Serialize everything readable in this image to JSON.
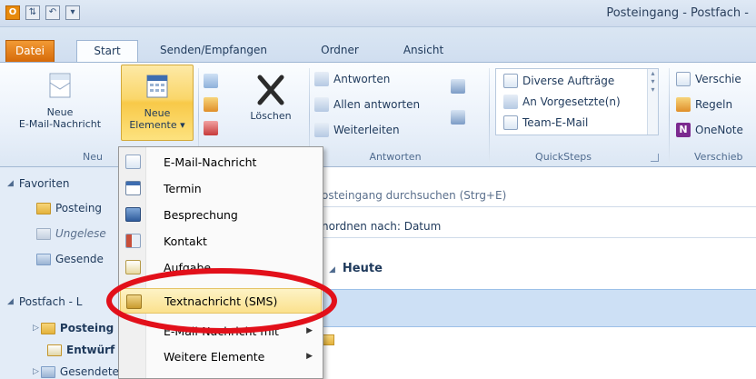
{
  "window": {
    "title": "Posteingang - Postfach - "
  },
  "qat": {
    "app_letter": "O"
  },
  "tabs": [
    {
      "label": "Datei"
    },
    {
      "label": "Start"
    },
    {
      "label": "Senden/Empfangen"
    },
    {
      "label": "Ordner"
    },
    {
      "label": "Ansicht"
    }
  ],
  "ribbon": {
    "neu": {
      "group_label": "Neu",
      "new_mail_line1": "Neue",
      "new_mail_line2": "E-Mail-Nachricht",
      "new_items_line1": "Neue",
      "new_items_line2": "Elemente ▾"
    },
    "loeschen": {
      "label": "Löschen"
    },
    "antworten": {
      "group_label": "Antworten",
      "reply": "Antworten",
      "reply_all": "Allen antworten",
      "forward": "Weiterleiten"
    },
    "quicksteps": {
      "group_label": "QuickSteps",
      "items": [
        "Diverse Aufträge",
        "An Vorgesetzte(n)",
        "Team-E-Mail"
      ]
    },
    "verschieben": {
      "group_label": "Verschieb",
      "move": "Verschie",
      "rules": "Regeln",
      "onenote": "OneNote"
    }
  },
  "nav": {
    "favorites_title": "Favoriten",
    "favorites": [
      "Posteing",
      "Ungelese",
      "Gesende"
    ],
    "mailbox_title": "Postfach - L",
    "mailbox": [
      "Posteing",
      "Entwürf",
      "Gesendete Elemente"
    ]
  },
  "main": {
    "search_placeholder": "osteingang durchsuchen (Strg+E)",
    "arrange": "nordnen nach: Datum",
    "today": "Heute"
  },
  "menu": {
    "items": [
      {
        "label": "E-Mail-Nachricht",
        "submenu": false
      },
      {
        "label": "Termin",
        "submenu": false
      },
      {
        "label": "Besprechung",
        "submenu": false
      },
      {
        "label": "Kontakt",
        "submenu": false
      },
      {
        "label": "Aufgabe",
        "submenu": false
      },
      {
        "label": "Textnachricht (SMS)",
        "submenu": false
      },
      {
        "label": "E-Mail-Nachricht mit",
        "submenu": true
      },
      {
        "label": "Weitere Elemente",
        "submenu": true
      }
    ],
    "highlighted_index": 5
  },
  "colors": {
    "accent_orange": "#e07a12",
    "highlight_red": "#e2101a",
    "ribbon_hot": "#fad66a"
  }
}
